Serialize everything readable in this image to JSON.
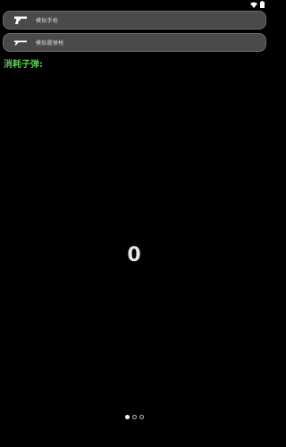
{
  "status_bar": {
    "icons": [
      "wifi-icon",
      "battery-icon"
    ]
  },
  "weapons": [
    {
      "label": "模拟手枪",
      "icon": "pistol-icon"
    },
    {
      "label": "模拟霰弹枪",
      "icon": "shotgun-icon"
    }
  ],
  "ammo": {
    "title": "消耗子弹:",
    "count": "0"
  },
  "pager": {
    "pages": 3,
    "active_index": 0
  },
  "colors": {
    "background": "#000000",
    "item_background": "#4a4a4a",
    "title_green": "#58c94e",
    "counter": "#e6e6e6"
  }
}
